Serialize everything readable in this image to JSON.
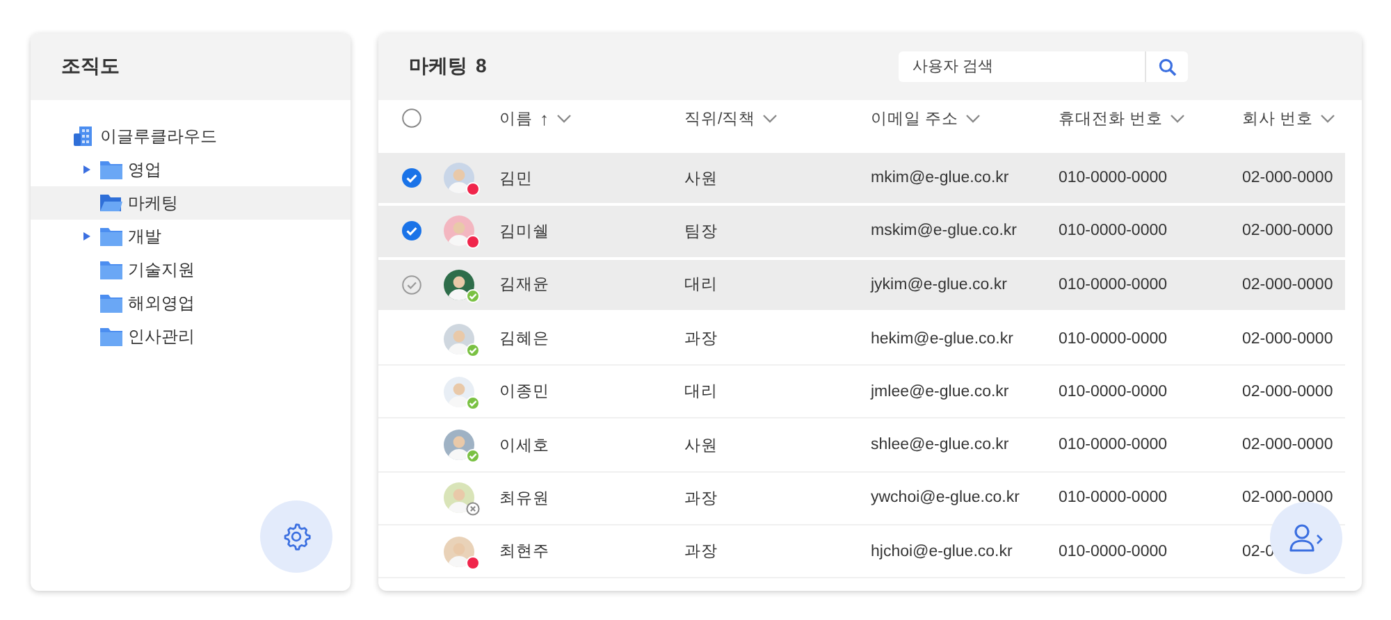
{
  "org_panel": {
    "title": "조직도",
    "tree": [
      {
        "label": "이글루클라우드",
        "kind": "company",
        "collapsed": false,
        "selected": false,
        "children": [
          {
            "label": "영업",
            "kind": "folder",
            "collapsed": true,
            "selected": false
          },
          {
            "label": "마케팅",
            "kind": "folder",
            "collapsed": false,
            "selected": true
          },
          {
            "label": "개발",
            "kind": "folder",
            "collapsed": true,
            "selected": false
          },
          {
            "label": "기술지원",
            "kind": "folder",
            "collapsed": false,
            "selected": false
          },
          {
            "label": "해외영업",
            "kind": "folder",
            "collapsed": false,
            "selected": false
          },
          {
            "label": "인사관리",
            "kind": "folder",
            "collapsed": false,
            "selected": false
          }
        ]
      }
    ]
  },
  "member_panel": {
    "title": "마케팅",
    "count": "8",
    "search": {
      "placeholder": "사용자 검색"
    },
    "columns": [
      {
        "label": "이름",
        "sort_arrow": "↑"
      },
      {
        "label": "직위/직책"
      },
      {
        "label": "이메일 주소"
      },
      {
        "label": "휴대전화 번호"
      },
      {
        "label": "회사 번호"
      }
    ],
    "header_checked": false,
    "rows": [
      {
        "name": "김민",
        "position": "사원",
        "email": "mkim@e-glue.co.kr",
        "mobile": "010-0000-0000",
        "company": "02-000-0000",
        "kind": "busy",
        "checked": true,
        "hovered": false
      },
      {
        "name": "김미쉘",
        "position": "팀장",
        "email": "mskim@e-glue.co.kr",
        "mobile": "010-0000-0000",
        "company": "02-000-0000",
        "kind": "busy",
        "checked": true,
        "hovered": false
      },
      {
        "name": "김재윤",
        "position": "대리",
        "email": "jykim@e-glue.co.kr",
        "mobile": "010-0000-0000",
        "company": "02-000-0000",
        "kind": "available",
        "checked": false,
        "hovered": true
      },
      {
        "name": "김혜은",
        "position": "과장",
        "email": "hekim@e-glue.co.kr",
        "mobile": "010-0000-0000",
        "company": "02-000-0000",
        "kind": "available",
        "checked": false,
        "hovered": false
      },
      {
        "name": "이종민",
        "position": "대리",
        "email": "jmlee@e-glue.co.kr",
        "mobile": "010-0000-0000",
        "company": "02-000-0000",
        "kind": "available",
        "checked": false,
        "hovered": false
      },
      {
        "name": "이세호",
        "position": "사원",
        "email": "shlee@e-glue.co.kr",
        "mobile": "010-0000-0000",
        "company": "02-000-0000",
        "kind": "available",
        "checked": false,
        "hovered": false
      },
      {
        "name": "최유원",
        "position": "과장",
        "email": "ywchoi@e-glue.co.kr",
        "mobile": "010-0000-0000",
        "company": "02-000-0000",
        "kind": "offline",
        "checked": false,
        "hovered": false
      },
      {
        "name": "최현주",
        "position": "과장",
        "email": "hjchoi@e-glue.co.kr",
        "mobile": "010-0000-0000",
        "company": "02-0",
        "kind": "busy",
        "checked": false,
        "hovered": false
      }
    ]
  }
}
